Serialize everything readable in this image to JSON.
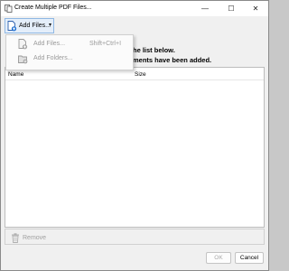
{
  "window": {
    "title": "Create Multiple PDF Files...",
    "minimize_glyph": "—",
    "maximize_glyph": "☐",
    "close_glyph": "✕"
  },
  "toolbar": {
    "add_files_label": "Add Files...",
    "add_files_icon": "add-file-icon",
    "dropdown_caret": "▾"
  },
  "menu": {
    "items": [
      {
        "label": "Add Files...",
        "shortcut": "Shift+Ctrl+I",
        "icon": "add-file-icon",
        "enabled": false
      },
      {
        "label": "Add Folders...",
        "shortcut": "",
        "icon": "add-folder-icon",
        "enabled": false
      }
    ]
  },
  "instructions": {
    "line1": "he list below.",
    "line2": "ments have been added."
  },
  "file_list": {
    "columns": [
      "Name",
      "Size"
    ],
    "rows": []
  },
  "bottom_bar": {
    "remove_label": "Remove",
    "remove_icon": "trash-icon"
  },
  "footer": {
    "ok_label": "OK",
    "cancel_label": "Cancel"
  },
  "colors": {
    "accent": "#1f6fd1",
    "disabled_text": "#9a9a9a",
    "window_bg": "#f0f0f0"
  }
}
